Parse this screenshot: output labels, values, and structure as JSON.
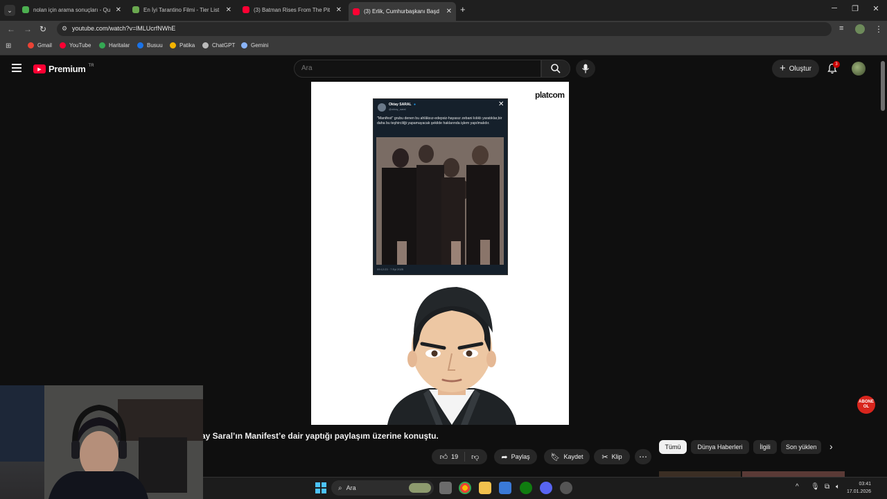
{
  "browser": {
    "tabs": [
      {
        "label": "nolan için arama sonuçları - Qu",
        "favicon_color": "#4caf50"
      },
      {
        "label": "En İyi Tarantino Filmi - Tier List",
        "favicon_color": "#6aa84f"
      },
      {
        "label": "(3) Batman Rises From The Pit",
        "favicon_color": "#ff0033"
      },
      {
        "label": "(3) Erlik, Cumhurbaşkanı Başd",
        "favicon_color": "#ff0033"
      }
    ],
    "url": "youtube.com/watch?v=lMLUcrfNWhE",
    "bookmarks": [
      {
        "label": "Gmail",
        "color": "#ea4335"
      },
      {
        "label": "YouTube",
        "color": "#ff0033"
      },
      {
        "label": "Haritalar",
        "color": "#34a853"
      },
      {
        "label": "Busuu",
        "color": "#1a73e8"
      },
      {
        "label": "Patika",
        "color": "#f4b400"
      },
      {
        "label": "ChatGPT",
        "color": "#bbbbbb"
      },
      {
        "label": "Gemini",
        "color": "#8ab4f8"
      }
    ]
  },
  "youtube": {
    "logo_text": "Premium",
    "region": "TR",
    "search_placeholder": "Ara",
    "create_label": "Oluştur",
    "notification_count": "3"
  },
  "tweet": {
    "author": "Oktay SARAL",
    "handle": "@oktay_saral",
    "text": "\"Manifest\" grubu denen bu ahlâksız-edepsiz-hayasız zebani kılıklı yaratıklar,bir daha bu teşhirciliği yapamayacak şekilde haklarında işlem yapılmalıdır.",
    "time": "09:12:23 · 7 Eyl 2025"
  },
  "video": {
    "watermark": "platcom",
    "subscribe_badge": "ABONE OL",
    "title": "ay Saral’ın Manifest’e dair yaptığı paylaşım üzerine konuştu.",
    "likes": "19",
    "share_label": "Paylaş",
    "save_label": "Kaydet",
    "clip_label": "Klip"
  },
  "chips": [
    {
      "label": "Tümü",
      "active": true
    },
    {
      "label": "Dünya Haberleri",
      "active": false
    },
    {
      "label": "İlgili",
      "active": false
    },
    {
      "label": "Son yüklen",
      "active": false
    }
  ],
  "taskbar": {
    "search_label": "Ara",
    "time": "03:41",
    "date": "17.01.2026"
  }
}
